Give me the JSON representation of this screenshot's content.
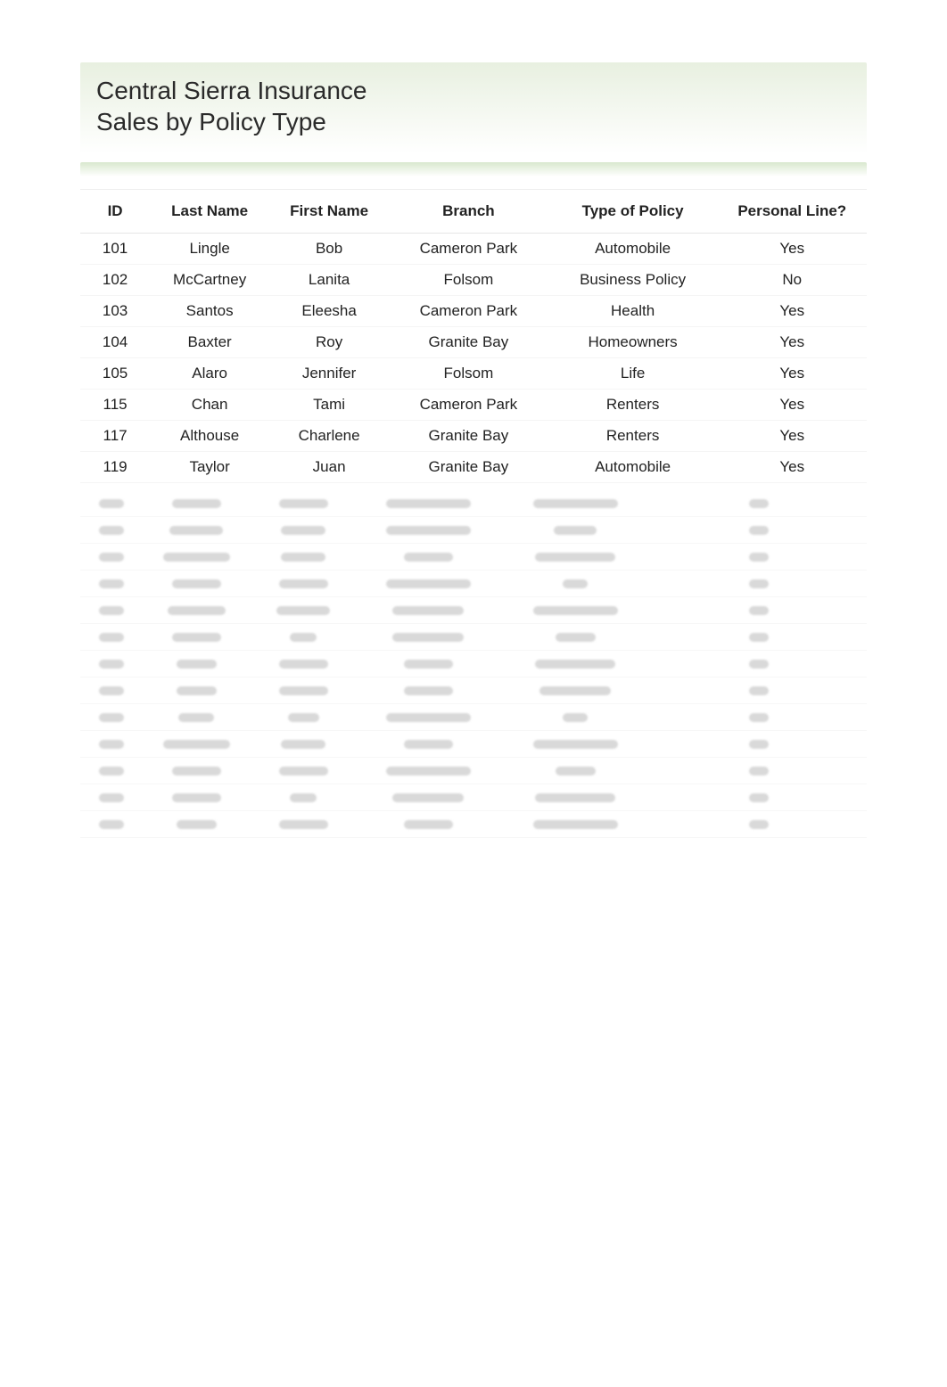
{
  "header": {
    "line1": "Central Sierra Insurance",
    "line2": "Sales by Policy Type"
  },
  "table": {
    "columns": [
      "ID",
      "Last Name",
      "First Name",
      "Branch",
      "Type of Policy",
      "Personal Line?"
    ],
    "rows": [
      {
        "id": "101",
        "last": "Lingle",
        "first": "Bob",
        "branch": "Cameron Park",
        "policy": "Automobile",
        "personal": "Yes"
      },
      {
        "id": "102",
        "last": "McCartney",
        "first": "Lanita",
        "branch": "Folsom",
        "policy": "Business Policy",
        "personal": "No"
      },
      {
        "id": "103",
        "last": "Santos",
        "first": "Eleesha",
        "branch": "Cameron Park",
        "policy": "Health",
        "personal": "Yes"
      },
      {
        "id": "104",
        "last": "Baxter",
        "first": "Roy",
        "branch": "Granite Bay",
        "policy": "Homeowners",
        "personal": "Yes"
      },
      {
        "id": "105",
        "last": "Alaro",
        "first": "Jennifer",
        "branch": "Folsom",
        "policy": "Life",
        "personal": "Yes"
      },
      {
        "id": "115",
        "last": "Chan",
        "first": "Tami",
        "branch": "Cameron Park",
        "policy": "Renters",
        "personal": "Yes"
      },
      {
        "id": "117",
        "last": "Althouse",
        "first": "Charlene",
        "branch": "Granite Bay",
        "policy": "Renters",
        "personal": "Yes"
      },
      {
        "id": "119",
        "last": "Taylor",
        "first": "Juan",
        "branch": "Granite Bay",
        "policy": "Automobile",
        "personal": "Yes"
      }
    ],
    "blurred_row_count": 13
  }
}
